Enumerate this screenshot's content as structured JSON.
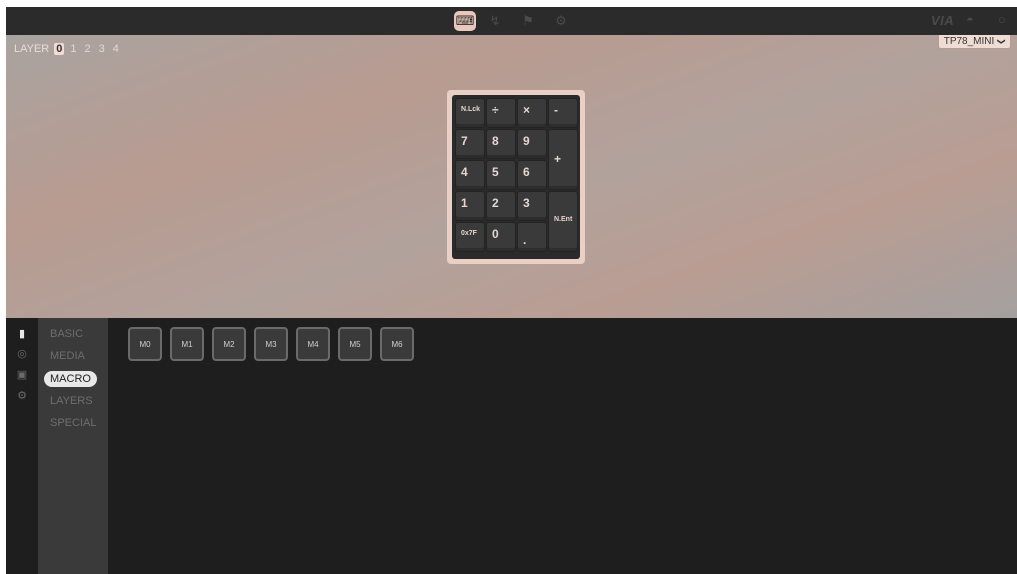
{
  "app": {
    "brand": "VIA"
  },
  "topbar": {
    "nav": [
      {
        "icon": "keyboard-icon",
        "glyph": "⌨",
        "active": true
      },
      {
        "icon": "test-icon",
        "glyph": "↯",
        "active": false
      },
      {
        "icon": "design-icon",
        "glyph": "⚑",
        "active": false
      },
      {
        "icon": "settings-icon",
        "glyph": "⚙",
        "active": false
      }
    ],
    "discord_glyph": "◓",
    "github_glyph": "○"
  },
  "layers": {
    "label": "LAYER",
    "numbers": [
      "0",
      "1",
      "2",
      "3",
      "4"
    ],
    "selected": "0"
  },
  "device": {
    "name": "TP78_MINI",
    "chevron": "❯"
  },
  "keyboard": {
    "keys": [
      {
        "label": "N.Lck",
        "small": true
      },
      {
        "label": "÷",
        "small": false
      },
      {
        "label": "×",
        "small": false
      },
      {
        "label": "-",
        "small": false
      },
      {
        "label": "7",
        "small": false
      },
      {
        "label": "8",
        "small": false
      },
      {
        "label": "9",
        "small": false
      },
      {
        "label": "+",
        "small": false
      },
      {
        "label": "4",
        "small": false
      },
      {
        "label": "5",
        "small": false
      },
      {
        "label": "6",
        "small": false
      },
      {
        "label": "1",
        "small": false
      },
      {
        "label": "2",
        "small": false
      },
      {
        "label": "3",
        "small": false
      },
      {
        "label": "N.Ent",
        "small": true
      },
      {
        "label": "0x7F",
        "small": true
      },
      {
        "label": "0",
        "small": false
      },
      {
        "label": ".",
        "small": false
      }
    ]
  },
  "rail": [
    {
      "icon": "book-icon",
      "glyph": "▮",
      "active": true
    },
    {
      "icon": "lighting-icon",
      "glyph": "◎",
      "active": false
    },
    {
      "icon": "save-icon",
      "glyph": "▣",
      "active": false
    },
    {
      "icon": "settings-icon",
      "glyph": "⚙",
      "active": false
    }
  ],
  "categories": [
    "BASIC",
    "MEDIA",
    "MACRO",
    "LAYERS",
    "SPECIAL"
  ],
  "selected_category": "MACRO",
  "macros": [
    "M0",
    "M1",
    "M2",
    "M3",
    "M4",
    "M5",
    "M6"
  ]
}
